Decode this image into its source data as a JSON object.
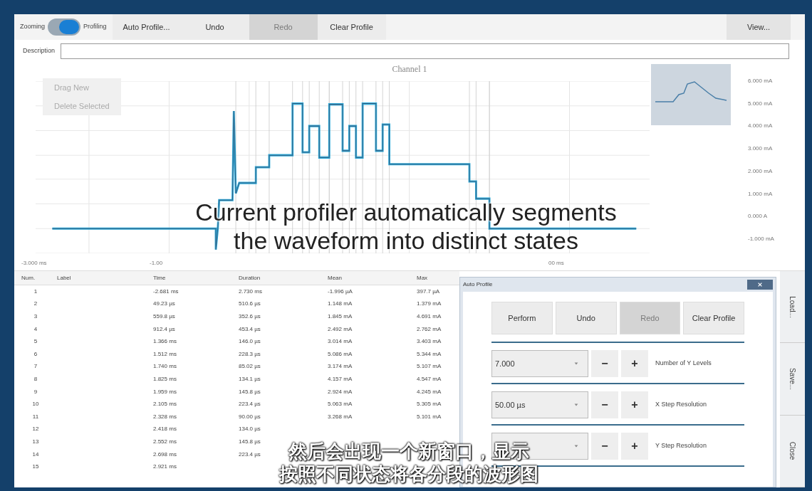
{
  "toolbar": {
    "toggle": {
      "left_label": "Zooming",
      "right_label": "Profiling",
      "on": true
    },
    "buttons": [
      {
        "label": "Auto Profile...",
        "disabled": false
      },
      {
        "label": "Undo",
        "disabled": false
      },
      {
        "label": "Redo",
        "disabled": true
      },
      {
        "label": "Clear Profile",
        "disabled": false
      }
    ],
    "view_button": "View..."
  },
  "description": {
    "label": "Description"
  },
  "chart": {
    "title": "Channel 1",
    "buttons": [
      "Drag New",
      "Delete Selected"
    ],
    "y_axis_labels": [
      "6.000 mA",
      "5.000 mA",
      "4.000 mA",
      "3.000 mA",
      "2.000 mA",
      "1.000 mA",
      "0.000 A",
      "-1.000 mA"
    ],
    "x_axis_labels": [
      "-3.000 ms",
      "-1.00",
      "00 ms"
    ]
  },
  "table": {
    "columns": [
      "Num.",
      "Label",
      "Time",
      "Duration",
      "Mean",
      "Max"
    ],
    "rows": [
      {
        "num": "1",
        "time": "-2.681 ms",
        "duration": "2.730 ms",
        "mean": "-1.996 µA",
        "max": "397.7 µA"
      },
      {
        "num": "2",
        "time": "49.23 µs",
        "duration": "510.6 µs",
        "mean": "1.148 mA",
        "max": "1.379 mA"
      },
      {
        "num": "3",
        "time": "559.8 µs",
        "duration": "352.6 µs",
        "mean": "1.845 mA",
        "max": "4.691 mA"
      },
      {
        "num": "4",
        "time": "912.4 µs",
        "duration": "453.4 µs",
        "mean": "2.492 mA",
        "max": "2.762 mA"
      },
      {
        "num": "5",
        "time": "1.366 ms",
        "duration": "146.0 µs",
        "mean": "3.014 mA",
        "max": "3.403 mA"
      },
      {
        "num": "6",
        "time": "1.512 ms",
        "duration": "228.3 µs",
        "mean": "5.086 mA",
        "max": "5.344 mA"
      },
      {
        "num": "7",
        "time": "1.740 ms",
        "duration": "85.02 µs",
        "mean": "3.174 mA",
        "max": "5.107 mA"
      },
      {
        "num": "8",
        "time": "1.825 ms",
        "duration": "134.1 µs",
        "mean": "4.157 mA",
        "max": "4.547 mA"
      },
      {
        "num": "9",
        "time": "1.959 ms",
        "duration": "145.8 µs",
        "mean": "2.924 mA",
        "max": "4.245 mA"
      },
      {
        "num": "10",
        "time": "2.105 ms",
        "duration": "223.4 µs",
        "mean": "5.063 mA",
        "max": "5.305 mA"
      },
      {
        "num": "11",
        "time": "2.328 ms",
        "duration": "90.00 µs",
        "mean": "3.268 mA",
        "max": "5.101 mA"
      },
      {
        "num": "12",
        "time": "2.418 ms",
        "duration": "134.0 µs"
      },
      {
        "num": "13",
        "time": "2.552 ms",
        "duration": "145.8 µs"
      },
      {
        "num": "14",
        "time": "2.698 ms",
        "duration": "223.4 µs"
      },
      {
        "num": "15",
        "time": "2.921 ms"
      }
    ]
  },
  "dialog": {
    "title": "Auto Profile",
    "buttons": [
      {
        "label": "Perform",
        "disabled": false
      },
      {
        "label": "Undo",
        "disabled": false
      },
      {
        "label": "Redo",
        "disabled": true
      },
      {
        "label": "Clear Profile",
        "disabled": false
      }
    ],
    "settings": [
      {
        "value": "7.000",
        "label": "Number of Y Levels",
        "minus": "−",
        "plus": "+"
      },
      {
        "value": "50.00 µs",
        "label": "X Step Resolution",
        "minus": "−",
        "plus": "+"
      },
      {
        "label": "Y Step Resolution",
        "minus": "−",
        "plus": "+"
      }
    ]
  },
  "side_tabs": [
    "Load...",
    "Save...",
    "Close"
  ],
  "captions": {
    "english": [
      "Current profiler automatically segments",
      "the waveform into distinct states"
    ],
    "chinese": [
      "然后会出现一个新窗口，显示",
      "按照不同状态将各分段的波形图"
    ]
  }
}
